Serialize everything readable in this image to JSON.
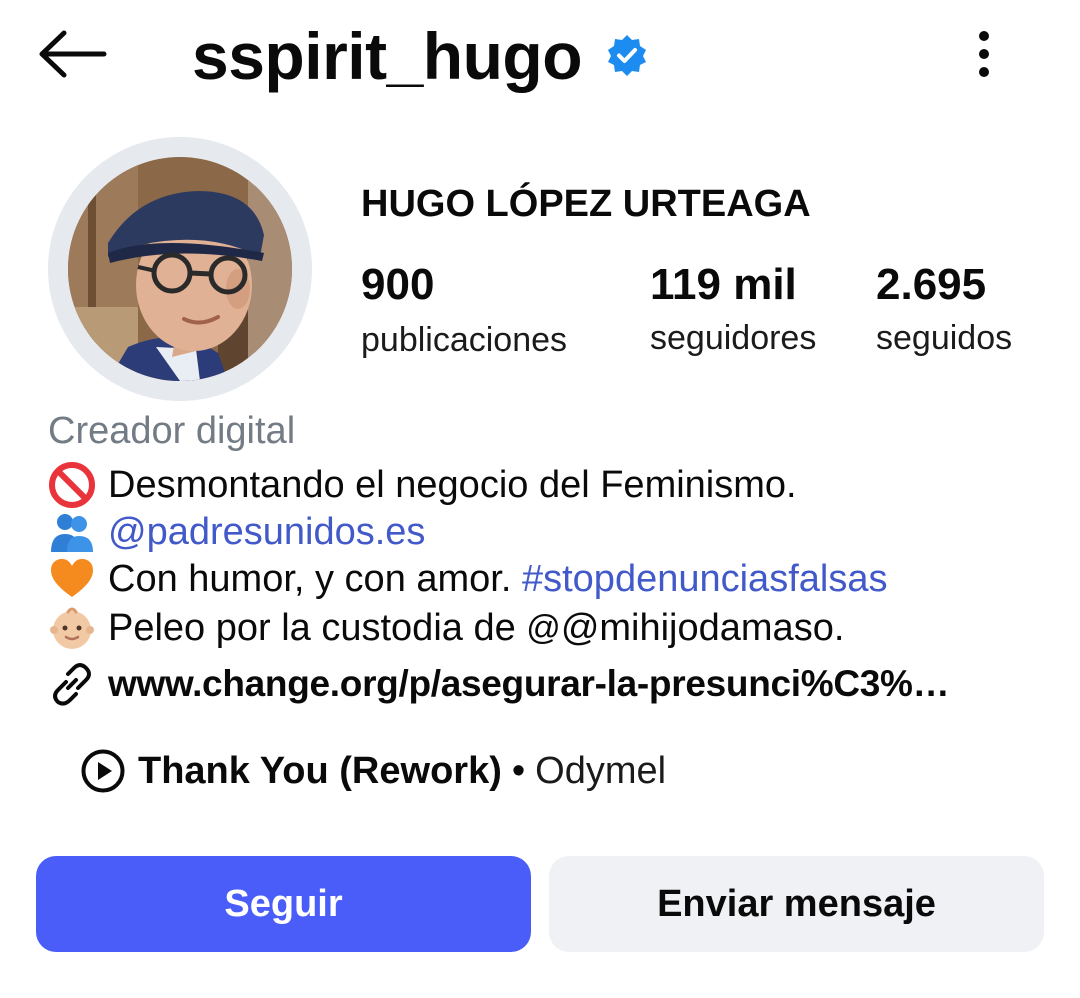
{
  "header": {
    "username": "sspirit_hugo",
    "verified": true
  },
  "profile": {
    "full_name": "HUGO LÓPEZ URTEAGA",
    "stats": {
      "posts_count": "900",
      "posts_label": "publicaciones",
      "followers_count": "119 mil",
      "followers_label": "seguidores",
      "following_count": "2.695",
      "following_label": "seguidos"
    },
    "category": "Creador digital",
    "bio": {
      "line1": "Desmontando el negocio del Feminismo.",
      "line2_mention": "@padresunidos.es",
      "line3_text": "Con humor, y con amor.",
      "line3_hashtag": "#stopdenunciasfalsas",
      "line4_text": "Peleo por la custodia de",
      "line4_threads": "@mihijodamaso."
    },
    "link": "www.change.org/p/asegurar-la-presunci%C3%…",
    "music": {
      "song": "Thank You (Rework)",
      "separator": "•",
      "artist": "Odymel"
    }
  },
  "actions": {
    "follow_label": "Seguir",
    "message_label": "Enviar mensaje"
  },
  "colors": {
    "primary_button": "#4a5df9",
    "secondary_button": "#eff1f4",
    "link_blue": "#4159c9",
    "verified_blue": "#1d8cf0",
    "category_gray": "#737b85"
  },
  "icons": {
    "back": "arrow-left-icon",
    "verified": "verified-badge-icon",
    "more": "more-vertical-icon",
    "no_entry": "no-entry-emoji-icon",
    "people": "people-hugging-emoji-icon",
    "heart": "orange-heart-emoji-icon",
    "baby": "baby-emoji-icon",
    "link": "link-icon",
    "play": "play-circle-icon"
  }
}
